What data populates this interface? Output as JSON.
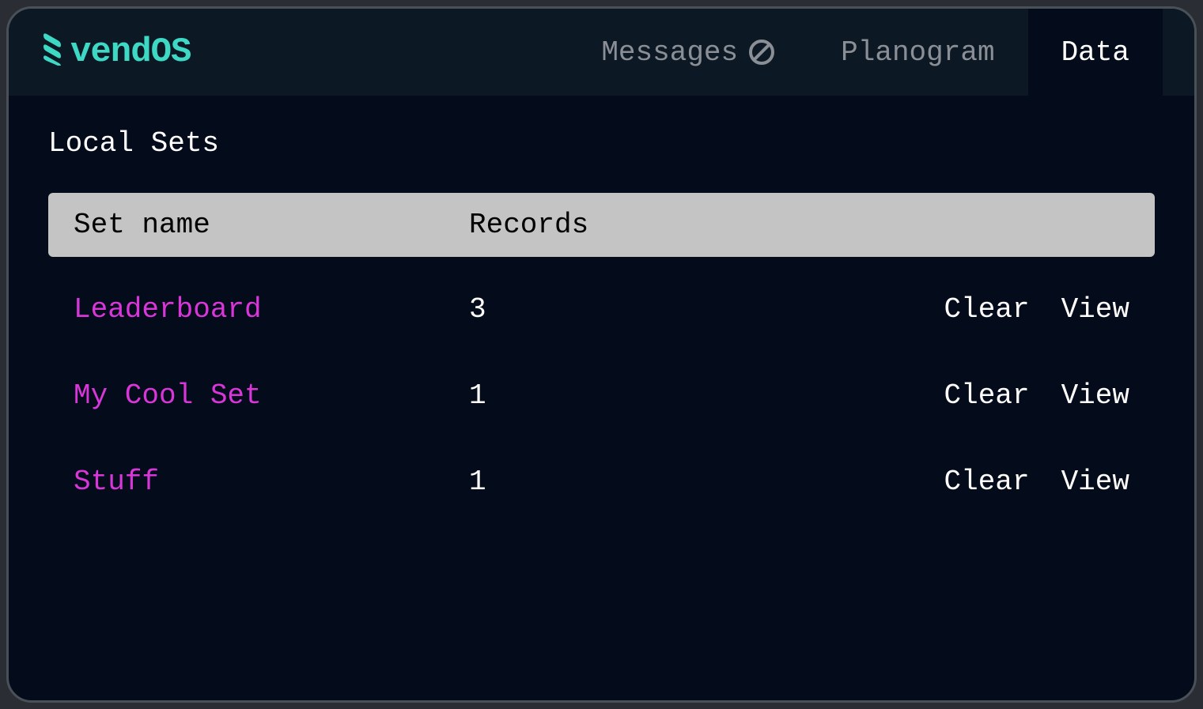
{
  "logo": {
    "text": "vendOS"
  },
  "nav": {
    "items": [
      {
        "label": "Messages",
        "disabled": true,
        "active": false
      },
      {
        "label": "Planogram",
        "disabled": false,
        "active": false
      },
      {
        "label": "Data",
        "disabled": false,
        "active": true
      }
    ]
  },
  "section": {
    "title": "Local Sets"
  },
  "table": {
    "headers": {
      "name": "Set name",
      "records": "Records"
    },
    "rows": [
      {
        "name": "Leaderboard",
        "records": "3",
        "clear": "Clear",
        "view": "View"
      },
      {
        "name": "My Cool Set",
        "records": "1",
        "clear": "Clear",
        "view": "View"
      },
      {
        "name": "Stuff",
        "records": "1",
        "clear": "Clear",
        "view": "View"
      }
    ]
  },
  "actions": {
    "clear": "Clear",
    "view": "View"
  }
}
